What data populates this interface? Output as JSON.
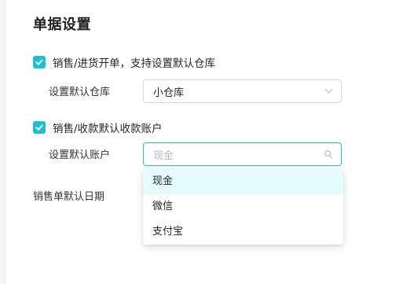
{
  "section": {
    "title": "单据设置"
  },
  "settings": {
    "warehouse_option": {
      "checked": true,
      "label": "销售/进货开单，支持设置默认仓库",
      "field_label": "设置默认仓库",
      "selected_value": "小仓库"
    },
    "account_option": {
      "checked": true,
      "label": "销售/收款默认收款账户",
      "field_label": "设置默认账户",
      "placeholder": "现金",
      "options": [
        "现金",
        "微信",
        "支付宝"
      ],
      "highlighted_option": "现金"
    },
    "date_option": {
      "field_label": "销售单默认日期"
    }
  },
  "icons": {
    "check": "check-icon",
    "dropdown_arrow": "chevron-down-icon",
    "search": "search-icon"
  },
  "colors": {
    "accent": "#1ec0d0",
    "option_highlight": "#e6fbfb"
  }
}
